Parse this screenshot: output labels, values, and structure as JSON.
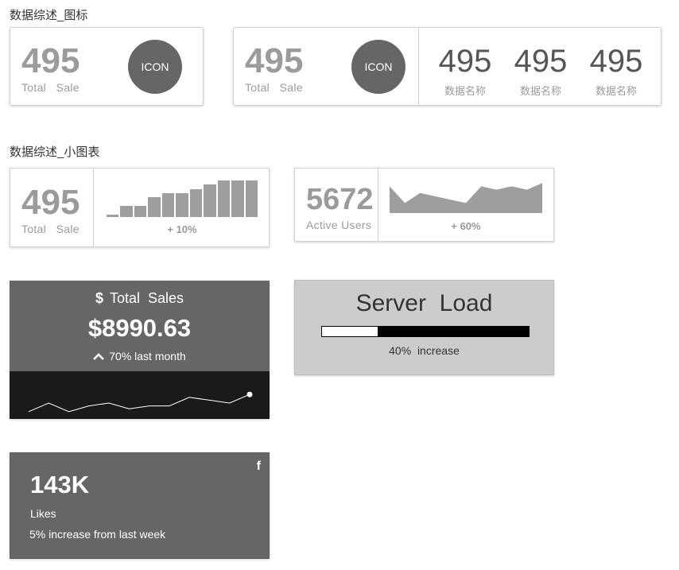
{
  "section1": {
    "title": "数据综述_图标"
  },
  "card1": {
    "value": "495",
    "label": "Total   Sale",
    "icon_text": "ICON"
  },
  "card2": {
    "value": "495",
    "label": "Total   Sale",
    "icon_text": "ICON",
    "stats": [
      {
        "value": "495",
        "label": "数据名称"
      },
      {
        "value": "495",
        "label": "数据名称"
      },
      {
        "value": "495",
        "label": "数据名称"
      }
    ]
  },
  "section2": {
    "title": "数据综述_小图表"
  },
  "card3": {
    "value": "495",
    "label": "Total   Sale",
    "change": "+ 10%",
    "bars": [
      1,
      3,
      3,
      5,
      6,
      6,
      7,
      8,
      9,
      9,
      9
    ]
  },
  "card4": {
    "value": "5672",
    "label": "Active Users",
    "change": "+ 60%",
    "area": [
      8,
      3,
      6,
      5,
      4,
      3,
      8,
      7,
      8,
      7,
      9
    ]
  },
  "sales_card": {
    "currency_icon": "$",
    "title": "Total  Sales",
    "amount": "$8990.63",
    "trend_text": "70% last month",
    "colors": {
      "top": "#666666",
      "bottom": "#1a1a1a"
    },
    "sparkline": [
      2,
      5,
      2,
      4,
      5,
      3,
      4,
      4,
      7,
      6,
      5,
      8
    ]
  },
  "server_card": {
    "title": "Server  Load",
    "progress": 0.27,
    "caption": "40%  increase"
  },
  "likes_card": {
    "icon": "facebook-icon",
    "icon_glyph": "f",
    "value": "143K",
    "label": "Likes",
    "caption": "5% increase from last week"
  }
}
